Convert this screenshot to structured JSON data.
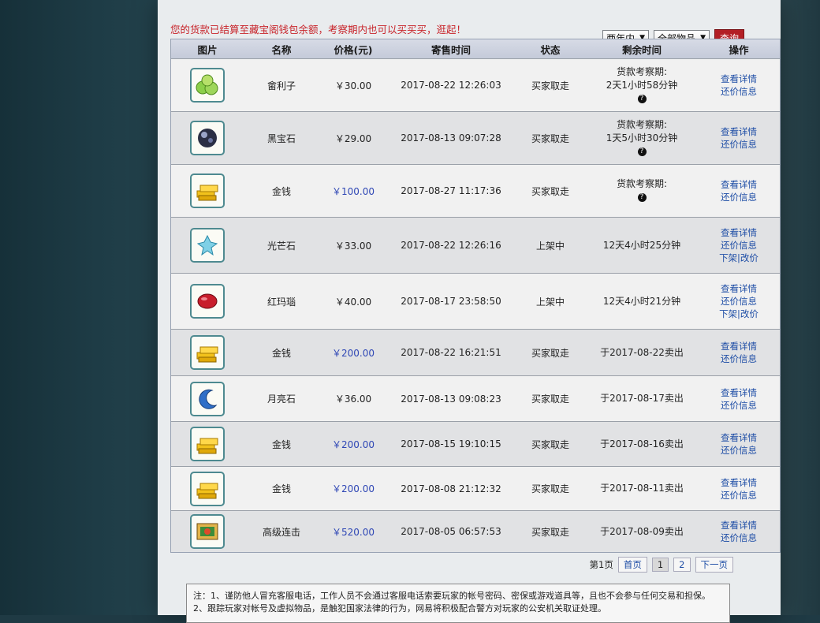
{
  "notice": "您的货款已结算至藏宝阁钱包余额，考察期内也可以买买买，逛起！",
  "filters": {
    "time": "两年内",
    "category": "全部物品",
    "query_label": "查询"
  },
  "columns": [
    "图片",
    "名称",
    "价格(元)",
    "寄售时间",
    "状态",
    "剩余时间",
    "操作"
  ],
  "rows": [
    {
      "icon": "green-plum-icon",
      "name": "畲利子",
      "price": "￥30.00",
      "time": "2017-08-22 12:26:03",
      "status": "买家取走",
      "remain": [
        "货款考察期:",
        "2天1小时58分钟"
      ],
      "help": true,
      "ops": [
        "查看详情",
        "还价信息"
      ]
    },
    {
      "icon": "black-gem-icon",
      "name": "黑宝石",
      "price": "￥29.00",
      "time": "2017-08-13 09:07:28",
      "status": "买家取走",
      "remain": [
        "货款考察期:",
        "1天5小时30分钟"
      ],
      "help": true,
      "ops": [
        "查看详情",
        "还价信息"
      ]
    },
    {
      "icon": "gold-bars-icon",
      "name": "金钱",
      "price": "￥100.00",
      "time": "2017-08-27 11:17:36",
      "status": "买家取走",
      "remain": [
        "货款考察期:",
        ""
      ],
      "help": true,
      "gold": true,
      "ops": [
        "查看详情",
        "还价信息"
      ]
    },
    {
      "icon": "shining-stone-icon",
      "name": "光芒石",
      "price": "￥33.00",
      "time": "2017-08-22 12:26:16",
      "status": "上架中",
      "remain": [
        "12天4小时25分钟"
      ],
      "ops": [
        "查看详情",
        "还价信息",
        "下架|改价"
      ]
    },
    {
      "icon": "red-agate-icon",
      "name": "红玛瑙",
      "price": "￥40.00",
      "time": "2017-08-17 23:58:50",
      "status": "上架中",
      "remain": [
        "12天4小时21分钟"
      ],
      "ops": [
        "查看详情",
        "还价信息",
        "下架|改价"
      ]
    },
    {
      "icon": "gold-bars-icon",
      "name": "金钱",
      "price": "￥200.00",
      "time": "2017-08-22 16:21:51",
      "status": "买家取走",
      "remain": [
        "于2017-08-22卖出"
      ],
      "gold": true,
      "ops": [
        "查看详情",
        "还价信息"
      ]
    },
    {
      "icon": "moon-stone-icon",
      "name": "月亮石",
      "price": "￥36.00",
      "time": "2017-08-13 09:08:23",
      "status": "买家取走",
      "remain": [
        "于2017-08-17卖出"
      ],
      "ops": [
        "查看详情",
        "还价信息"
      ]
    },
    {
      "icon": "gold-bars-icon",
      "name": "金钱",
      "price": "￥200.00",
      "time": "2017-08-15 19:10:15",
      "status": "买家取走",
      "remain": [
        "于2017-08-16卖出"
      ],
      "gold": true,
      "ops": [
        "查看详情",
        "还价信息"
      ]
    },
    {
      "icon": "gold-bars-icon",
      "name": "金钱",
      "price": "￥200.00",
      "time": "2017-08-08 21:12:32",
      "status": "买家取走",
      "remain": [
        "于2017-08-11卖出"
      ],
      "gold": true,
      "ops": [
        "查看详情",
        "还价信息"
      ]
    },
    {
      "icon": "combo-book-icon",
      "name": "高级连击",
      "price": "￥520.00",
      "time": "2017-08-05 06:57:53",
      "status": "买家取走",
      "remain": [
        "于2017-08-09卖出"
      ],
      "gold": true,
      "ops": [
        "查看详情",
        "还价信息"
      ]
    }
  ],
  "pager": {
    "current_label": "第1页",
    "first": "首页",
    "pages": [
      "1",
      "2"
    ],
    "next": "下一页"
  },
  "notes": [
    "注：1、谨防他人冒充客服电话，工作人员不会通过客服电话索要玩家的帐号密码、密保或游戏道具等，且也不会参与任何交易和担保。",
    "2、跟踪玩家对帐号及虚拟物品，是触犯国家法律的行为，网易将积极配合警方对玩家的公安机关取证处理。"
  ]
}
